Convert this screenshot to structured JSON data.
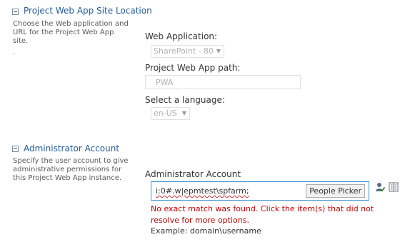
{
  "pwa_site": {
    "title": "Project Web App Site Location",
    "description": "Choose the Web application and URL for the Project Web App site.",
    "note": ".",
    "web_app_label": "Web Application:",
    "web_app_value": "SharePoint - 80",
    "path_label": "Project Web App path:",
    "path_value": "PWA",
    "language_label": "Select a language:",
    "language_value": "en-US"
  },
  "admin": {
    "title": "Administrator Account",
    "description": "Specify the user account to give administrative permissions for this Project Web App instance.",
    "field_label": "Administrator Account",
    "account_value": "i:0#.w|epmtest\\spfarm;",
    "picker_label": "People Picker",
    "error_message": "No exact match was found. Click the item(s) that did not resolve for more options.",
    "example": "Example: domain\\username"
  },
  "colors": {
    "section_title": "#1f5a9a",
    "error": "#c00000",
    "input_focus_border": "#3b8fd3"
  },
  "icons": [
    "collapse-icon",
    "check-names-icon",
    "address-book-icon",
    "dropdown-arrow-icon"
  ]
}
